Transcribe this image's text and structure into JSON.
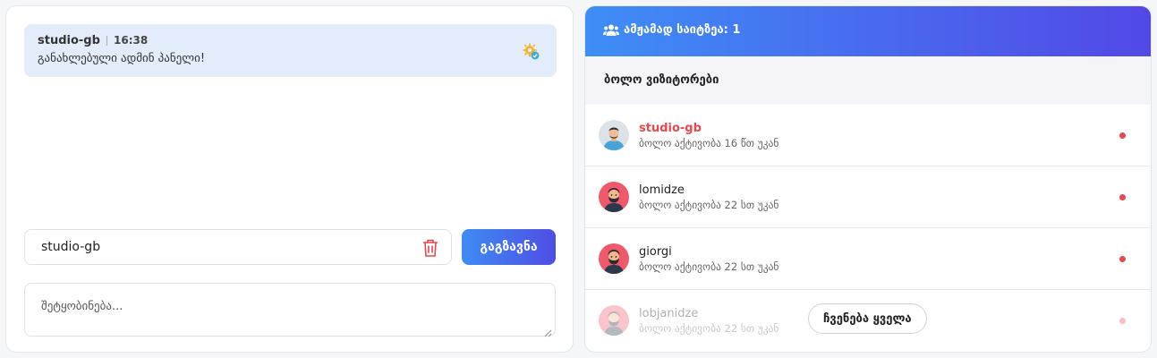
{
  "chat": {
    "message": {
      "user": "studio-gb",
      "time": "16:38",
      "text": "განახლებული ადმინ პანელი!",
      "icon": "gear-check-icon"
    },
    "name_value": "studio-gb",
    "send_label": "გაგზავნა",
    "message_placeholder": "შეტყობინება..."
  },
  "online": {
    "header_title": "ამჟამად საიტზეა: 1",
    "visitors_title": "ბოლო ვიზიტორები",
    "show_all_label": "ჩვენება ყველა",
    "status_color": "#e8474f",
    "visitors": [
      {
        "name": "studio-gb",
        "status": "ბოლო აქტივობა 16 წთ უკან"
      },
      {
        "name": "lomidze",
        "status": "ბოლო აქტივობა 22 სთ უკან"
      },
      {
        "name": "giorgi",
        "status": "ბოლო აქტივობა 22 სთ უკან"
      },
      {
        "name": "lobjanidze",
        "status": "ბოლო აქტივობა 22 სთ უკან"
      }
    ]
  }
}
